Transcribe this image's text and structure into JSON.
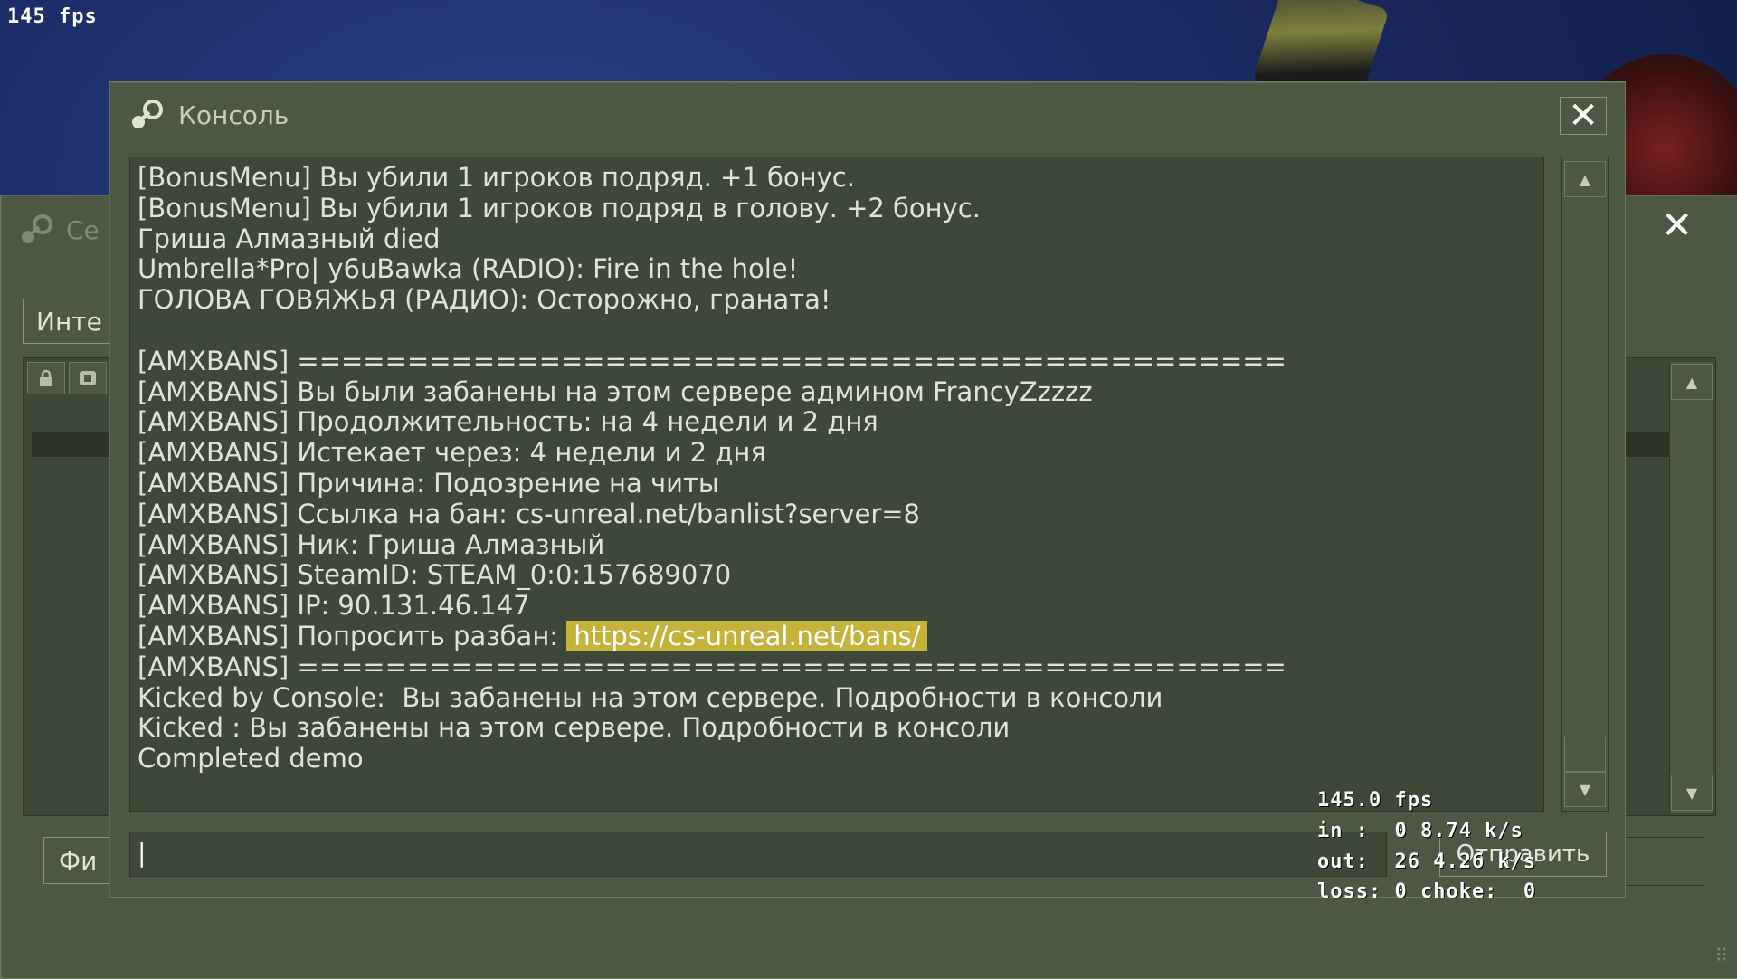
{
  "overlay": {
    "fps_top": "145 fps"
  },
  "server_window": {
    "title_partial": "Се",
    "tab_partial": "Инте",
    "filter_partial": "Фи"
  },
  "console": {
    "title": "Консоль",
    "lines": [
      "[BonusMenu] Вы убили 1 игроков подряд. +1 бонус.",
      "[BonusMenu] Вы убили 1 игроков подряд в голову. +2 бонус.",
      "Гриша Алмазный died",
      "Umbrella*Pro| y6uBawka (RADIO): Fire in the hole!",
      "ГОЛОВА ГОВЯЖЬЯ (РАДИО): Осторожно, граната!",
      "",
      "[AMXBANS] =============================================",
      "[AMXBANS] Вы были забанены на этом сервере админом FrancyZzzzz",
      "[AMXBANS] Продолжительность: на 4 недели и 2 дня",
      "[AMXBANS] Истекает через: 4 недели и 2 дня",
      "[AMXBANS] Причина: Подозрение на читы",
      "[AMXBANS] Ссылка на бан: cs-unreal.net/banlist?server=8",
      "[AMXBANS] Ник: Гриша Алмазный",
      "[AMXBANS] SteamID: STEAM_0:0:157689070",
      "[AMXBANS] IP: 90.131.46.147",
      "[AMXBANS] Попросить разбан: ",
      "[AMXBANS] =============================================",
      "Kicked by Console:  Вы забанены на этом сервере. Подробности в консоли",
      "Kicked : Вы забанены на этом сервере. Подробности в консоли",
      "Completed demo"
    ],
    "unban_link": "https://cs-unreal.net/bans/",
    "input_value": "|",
    "submit_label": "Отправить"
  },
  "netgraph": {
    "fps": "145.0 fps",
    "in": "in :  0 8.74 k/s",
    "out": "out:  26 4.26 k/s",
    "loss": "loss: 0 choke:  0"
  },
  "colors": {
    "window_bg": "#4c5844",
    "panel_bg": "#3e4838",
    "text": "#dfe3d6",
    "link_highlight": "#c4b23a"
  },
  "icons": [
    "steam-icon",
    "close-icon",
    "lock-icon",
    "scroll-up-icon",
    "scroll-down-icon",
    "resize-grip-icon"
  ]
}
